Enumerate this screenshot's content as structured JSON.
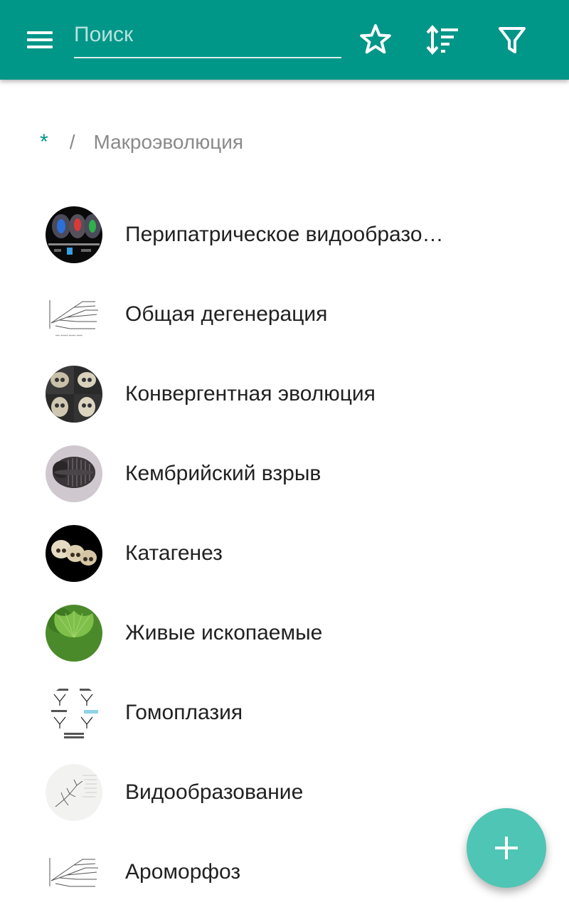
{
  "toolbar": {
    "menu_icon": "hamburger-menu-icon",
    "search_placeholder": "Поиск",
    "search_value": "",
    "favorites_icon": "star-outline-icon",
    "sort_icon": "sort-icon",
    "filter_icon": "filter-icon",
    "background": "#009688"
  },
  "breadcrumb": {
    "root": "*",
    "separator": "/",
    "current": "Макроэволюция"
  },
  "items": [
    {
      "title": "Перипатрическое видообразование",
      "image": "brain-scan-image"
    },
    {
      "title": "Общая дегенерация",
      "image": "phylogeny-diagram-image"
    },
    {
      "title": "Конвергентная эволюция",
      "image": "skulls-comparison-image"
    },
    {
      "title": "Кембрийский взрыв",
      "image": "trilobite-fossil-image"
    },
    {
      "title": "Катагенез",
      "image": "primate-skulls-image"
    },
    {
      "title": "Живые ископаемые",
      "image": "ginkgo-leaf-image"
    },
    {
      "title": "Гомоплазия",
      "image": "cladogram-image"
    },
    {
      "title": "Видообразование",
      "image": "darwin-tree-sketch-image"
    },
    {
      "title": "Ароморфоз",
      "image": "phylogeny-diagram-image"
    }
  ],
  "fab": {
    "icon": "plus-icon",
    "color": "#4fc5b5"
  },
  "colors": {
    "accent": "#009688",
    "text": "#212121",
    "muted": "#8a8a8a"
  }
}
